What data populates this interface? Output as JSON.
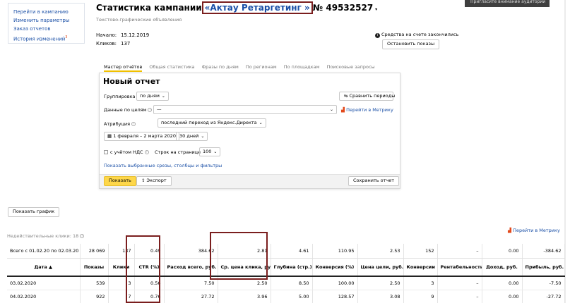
{
  "nav": {
    "items": [
      "Перейти в кампанию",
      "Изменить параметры",
      "Заказ отчетов",
      "История изменений"
    ],
    "history_badge": "3"
  },
  "header": {
    "title_prefix": "Статистика кампании",
    "campaign_name": "«Актау Ретаргетинг »",
    "campaign_number": "№ 49532527",
    "subtitle": "Текстово-графические объявления",
    "start_label": "Начало:",
    "start_value": "15.12.2019",
    "clicks_label": "Кликов:",
    "clicks_value": "137",
    "funds_notice": "Средства на счете закончились",
    "stop_button": "Остановить показы",
    "toast": "Пригласите внимание аудитории"
  },
  "tabs": [
    "Мастер отчётов",
    "Общая статистика",
    "Фразы по дням",
    "По регионам",
    "По площадкам",
    "Поисковые запросы"
  ],
  "report": {
    "title": "Новый отчет",
    "grouping_label": "Группировка",
    "grouping_value": "по дням",
    "compare_button": "Сравнить периоды",
    "goals_label": "Данные по целям",
    "goals_value": "—",
    "metrika_link": "Перейти в Метрику",
    "attribution_label": "Атрибуция",
    "attribution_value": "последний переход из Яндекс.Директа",
    "date_range": "1 февраля – 2 марта 2020",
    "period_value": "30 дней",
    "vat_label": "с учётом НДС",
    "rows_label": "Строк на странице",
    "rows_value": "100",
    "filters_link": "Показать выбранные срезы, столбцы и фильтры",
    "show_button": "Показать",
    "export_button": "Экспорт",
    "save_button": "Сохранить отчет"
  },
  "chart_button": "Показать график",
  "invalid_clicks": "Недействительные клики: 18",
  "metrika_link2": "Перейти в Метрику",
  "table": {
    "total_label": "Всего с 01.02.20 по 02.03.20",
    "total": [
      "28 069",
      "137",
      "0.49",
      "384.62",
      "2.81",
      "4.61",
      "110.95",
      "2.53",
      "152",
      "–",
      "0.00",
      "-384.62"
    ],
    "headers": [
      "Дата ▲",
      "Показы",
      "Клики",
      "CTR (%)",
      "Расход всего, руб.",
      "Ср. цена клика, руб.",
      "Глубина (стр.)",
      "Конверсия (%)",
      "Цена цели, руб.",
      "Конверсии",
      "Рентабельность",
      "Доход, руб.",
      "Прибыль, руб."
    ],
    "rows": [
      [
        "03.02.2020",
        "539",
        "3",
        "0.56",
        "7.50",
        "2.50",
        "8.50",
        "100.00",
        "2.50",
        "3",
        "–",
        "0.00",
        "-7.50"
      ],
      [
        "04.02.2020",
        "922",
        "7",
        "0.76",
        "27.72",
        "3.96",
        "5.00",
        "128.57",
        "3.08",
        "9",
        "–",
        "0.00",
        "-27.72"
      ]
    ]
  }
}
